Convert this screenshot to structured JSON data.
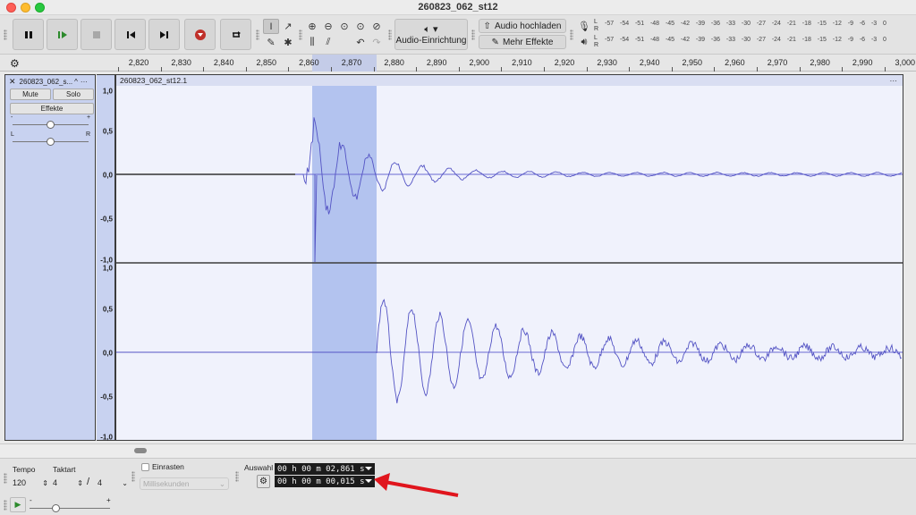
{
  "window": {
    "title": "260823_062_st12"
  },
  "toolbar": {
    "pause_icon": "pause-icon",
    "play_icon": "play-icon",
    "stop_icon": "stop-icon",
    "skip_start_icon": "skip-to-start-icon",
    "skip_end_icon": "skip-to-end-icon",
    "record_icon": "record-icon",
    "loop_icon": "loop-icon",
    "audio_setup_label": "Audio-Einrichtung",
    "upload_label": "Audio hochladen",
    "effects_label": "Mehr Effekte"
  },
  "meters": {
    "scale": [
      "-57",
      "-54",
      "-51",
      "-48",
      "-45",
      "-42",
      "-39",
      "-36",
      "-33",
      "-30",
      "-27",
      "-24",
      "-21",
      "-18",
      "-15",
      "-12",
      "-9",
      "-6",
      "-3",
      "0"
    ],
    "record_left": "L",
    "record_right": "R",
    "play_left": "L",
    "play_right": "R"
  },
  "ruler": {
    "ticks": [
      "2,820",
      "2,830",
      "2,840",
      "2,850",
      "2,860",
      "2,870",
      "2,880",
      "2,890",
      "2,900",
      "2,910",
      "2,920",
      "2,930",
      "2,940",
      "2,950",
      "2,960",
      "2,970",
      "2,980",
      "2,990",
      "3,000"
    ]
  },
  "track": {
    "name": "260823_062_s...",
    "mute_label": "Mute",
    "solo_label": "Solo",
    "effects_label": "Effekte",
    "gain_minus": "-",
    "gain_plus": "+",
    "pan_left": "L",
    "pan_right": "R",
    "clip_title": "260823_062_st12.1",
    "scale_labels": [
      "1,0",
      "0,5",
      "0,0",
      "-0,5",
      "-1,0"
    ]
  },
  "bottom": {
    "tempo_label": "Tempo",
    "tempo_value": "120",
    "meter_label": "Taktart",
    "meter_num": "4",
    "meter_sep": "/",
    "meter_den": "4",
    "snap_label": "Einrasten",
    "snap_unit": "Millisekunden",
    "selection_label": "Auswahl",
    "selection_start": "00 h 00 m 02,861 s",
    "selection_length": "00 h 00 m 00,015 s",
    "play_speed_minus": "-",
    "play_speed_plus": "+"
  }
}
